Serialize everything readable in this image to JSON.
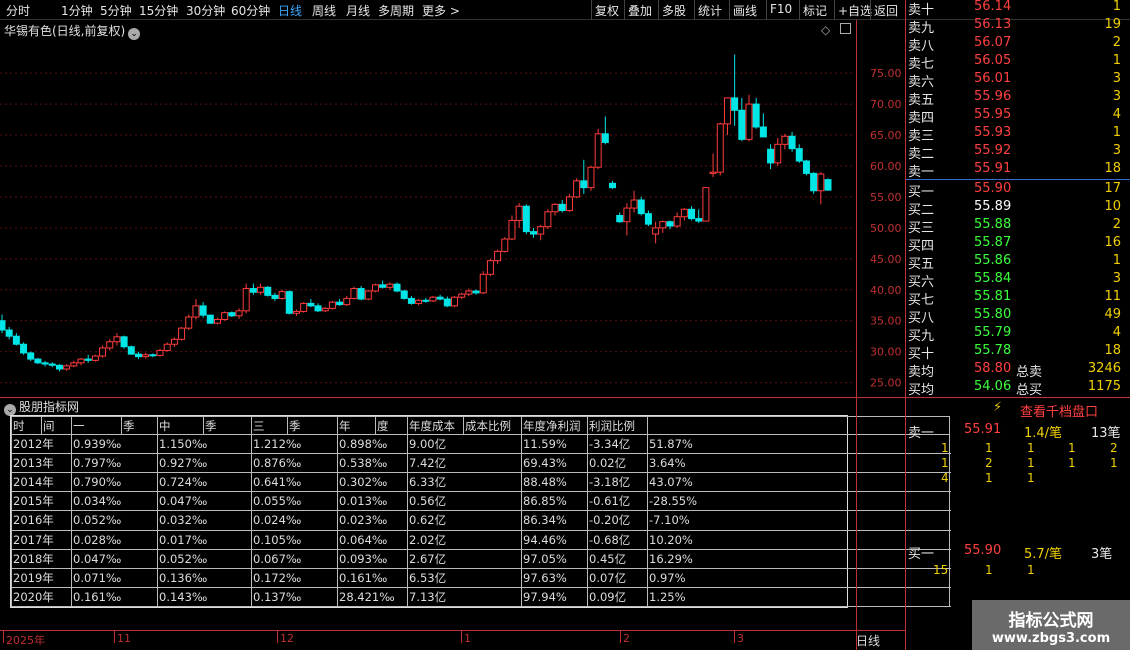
{
  "toolbar": {
    "periods": [
      "分时",
      "1分钟",
      "5分钟",
      "15分钟",
      "30分钟",
      "60分钟",
      "日线",
      "周线",
      "月线",
      "多周期",
      "更多 >"
    ],
    "active": "日线",
    "right_buttons": [
      "复权",
      "叠加",
      "多股",
      "统计",
      "画线",
      "F10",
      "标记",
      "+自选",
      "返回"
    ]
  },
  "chart": {
    "title": "华锡有色(日线,前复权)",
    "y_ticks": [
      "75.00",
      "70.00",
      "65.00",
      "60.00",
      "55.00",
      "50.00",
      "45.00",
      "40.00",
      "35.00",
      "30.00",
      "25.00"
    ],
    "x_ticks": [
      "2025年",
      "11",
      "12",
      "1",
      "2",
      "3"
    ],
    "period_label": "日线"
  },
  "chart_data": {
    "type": "candlestick",
    "title": "华锡有色(日线,前复权)",
    "ylim": [
      23,
      81
    ],
    "up_color": "#ff3c3c",
    "down_color": "#00e5e5",
    "ohlc": [
      [
        35,
        36,
        33,
        33.5
      ],
      [
        33.5,
        34,
        32,
        32.5
      ],
      [
        32.5,
        33,
        31,
        31.2
      ],
      [
        31.2,
        31.5,
        29.5,
        29.8
      ],
      [
        29.8,
        30,
        28.5,
        28.8
      ],
      [
        28.8,
        29,
        28,
        28.2
      ],
      [
        28.2,
        28.5,
        27.6,
        28
      ],
      [
        28,
        28.3,
        27.5,
        27.8
      ],
      [
        27.8,
        28,
        26.8,
        27.2
      ],
      [
        27.2,
        28,
        26.9,
        27.7
      ],
      [
        27.7,
        28.5,
        27.5,
        28.2
      ],
      [
        28.2,
        29,
        27.8,
        28.8
      ],
      [
        28.8,
        29.5,
        28.2,
        28.6
      ],
      [
        28.6,
        29.5,
        28.4,
        29.3
      ],
      [
        29.3,
        31,
        29,
        30.6
      ],
      [
        30.6,
        32,
        30.2,
        31.6
      ],
      [
        31.6,
        33,
        31,
        32.4
      ],
      [
        32.4,
        32.6,
        30.5,
        30.8
      ],
      [
        30.8,
        31,
        29.5,
        29.6
      ],
      [
        29.6,
        30,
        28.8,
        29.2
      ],
      [
        29.2,
        29.8,
        28.9,
        29.5
      ],
      [
        29.5,
        29.7,
        29.1,
        29.4
      ],
      [
        29.4,
        30.5,
        29.2,
        30.2
      ],
      [
        30.2,
        31.5,
        30,
        31.2
      ],
      [
        31.2,
        32.3,
        30.8,
        32
      ],
      [
        32,
        34,
        31.8,
        33.8
      ],
      [
        33.8,
        36,
        33.5,
        35.6
      ],
      [
        35.6,
        38.5,
        35.2,
        37.4
      ],
      [
        37.4,
        38,
        35.5,
        35.9
      ],
      [
        35.9,
        36,
        34.5,
        34.6
      ],
      [
        34.6,
        35.5,
        34.4,
        35.2
      ],
      [
        35.2,
        36.5,
        35,
        36.3
      ],
      [
        36.3,
        36.5,
        35.6,
        35.8
      ],
      [
        35.8,
        37,
        35.3,
        36.6
      ],
      [
        36.6,
        41,
        36.2,
        40.2
      ],
      [
        40.2,
        41,
        39.2,
        39.6
      ],
      [
        39.6,
        41,
        39.2,
        40.4
      ],
      [
        40.4,
        40.6,
        38.9,
        39.1
      ],
      [
        39.1,
        39.5,
        38.2,
        38.6
      ],
      [
        38.6,
        40,
        38.4,
        39.7
      ],
      [
        39.7,
        39.9,
        36,
        36.2
      ],
      [
        36.2,
        36.8,
        35.8,
        36.5
      ],
      [
        36.5,
        38,
        36.3,
        37.8
      ],
      [
        37.8,
        38.5,
        37.2,
        37.4
      ],
      [
        37.4,
        37.8,
        36.4,
        36.6
      ],
      [
        36.6,
        37.2,
        36.4,
        37
      ],
      [
        37,
        38.2,
        36.8,
        38
      ],
      [
        38,
        38.5,
        37.4,
        37.6
      ],
      [
        37.6,
        39,
        37.4,
        38.6
      ],
      [
        38.6,
        40.5,
        38.4,
        40.2
      ],
      [
        40.2,
        40.6,
        38.3,
        38.5
      ],
      [
        38.5,
        40,
        38.3,
        39.8
      ],
      [
        39.8,
        41,
        39.6,
        40.8
      ],
      [
        40.8,
        41.5,
        40.2,
        40.4
      ],
      [
        40.4,
        41.2,
        40,
        40.9
      ],
      [
        40.9,
        41.2,
        39.6,
        39.8
      ],
      [
        39.8,
        40,
        38.4,
        38.6
      ],
      [
        38.6,
        39,
        37.6,
        37.8
      ],
      [
        37.8,
        38.5,
        37.5,
        38.3
      ],
      [
        38.3,
        38.7,
        37.9,
        38.2
      ],
      [
        38.2,
        39,
        38,
        38.8
      ],
      [
        38.8,
        39.2,
        38.3,
        38.5
      ],
      [
        38.5,
        38.9,
        37.2,
        37.4
      ],
      [
        37.4,
        39,
        37.2,
        38.8
      ],
      [
        38.8,
        39.5,
        38.5,
        39.3
      ],
      [
        39.3,
        40.2,
        39,
        39.8
      ],
      [
        39.8,
        40,
        39.2,
        39.5
      ],
      [
        39.5,
        43,
        39.3,
        42.5
      ],
      [
        42.5,
        45,
        42.2,
        44.7
      ],
      [
        44.7,
        46.5,
        44.2,
        46.2
      ],
      [
        46.2,
        48.5,
        46,
        48.2
      ],
      [
        48.2,
        52,
        48,
        51.2
      ],
      [
        51.2,
        54,
        50,
        53.5
      ],
      [
        53.5,
        53.8,
        49,
        49.4
      ],
      [
        49.4,
        50,
        48.4,
        49
      ],
      [
        49,
        50.5,
        48,
        50.2
      ],
      [
        50.2,
        53,
        49.8,
        52.6
      ],
      [
        52.6,
        54,
        52,
        53.8
      ],
      [
        53.8,
        54.5,
        52.5,
        52.8
      ],
      [
        52.8,
        55.5,
        52.6,
        55
      ],
      [
        55,
        58,
        54.8,
        57.6
      ],
      [
        57.6,
        61,
        55.5,
        56.5
      ],
      [
        56.5,
        60,
        56,
        59.8
      ],
      [
        59.8,
        66,
        59.5,
        65.2
      ],
      [
        65.2,
        68,
        63.5,
        63.8
      ],
      [
        57.2,
        57.6,
        56.3,
        56.5
      ],
      [
        52,
        52.5,
        50.8,
        51
      ],
      [
        51,
        54,
        48.8,
        53.2
      ],
      [
        53.2,
        56,
        52.5,
        54.5
      ],
      [
        54.5,
        55,
        52,
        52.3
      ],
      [
        52.3,
        52.8,
        50.3,
        50.6
      ],
      [
        49,
        51,
        47.5,
        50
      ],
      [
        50,
        51.2,
        49.2,
        51
      ],
      [
        51,
        51.2,
        49.8,
        50.3
      ],
      [
        50.3,
        52.5,
        50,
        51.8
      ],
      [
        51.8,
        53.2,
        51.2,
        53
      ],
      [
        53,
        53.5,
        51.2,
        51.5
      ],
      [
        51.5,
        53,
        50.8,
        51.1
      ],
      [
        51.1,
        56,
        51,
        56.5
      ],
      [
        58.8,
        62,
        58.2,
        59
      ],
      [
        59,
        67,
        58.5,
        66.8
      ],
      [
        66.8,
        71,
        65,
        71
      ],
      [
        71,
        78,
        66.5,
        69
      ],
      [
        69,
        71,
        64,
        64.3
      ],
      [
        64.3,
        71.5,
        64,
        70
      ],
      [
        70,
        71,
        66,
        66.3
      ],
      [
        66.3,
        68.5,
        65.7,
        64.7
      ],
      [
        62.7,
        63.5,
        59.5,
        60.5
      ],
      [
        60.5,
        64.5,
        60,
        63.5
      ],
      [
        63.5,
        65.2,
        62.7,
        64.8
      ],
      [
        64.8,
        65.5,
        62.3,
        62.8
      ],
      [
        62.8,
        63.5,
        60.5,
        60.8
      ],
      [
        60.8,
        61,
        58.5,
        58.8
      ],
      [
        58.8,
        59,
        55.5,
        56
      ],
      [
        56,
        59,
        53.8,
        58.7
      ],
      [
        57.8,
        58,
        56,
        56.1
      ]
    ]
  },
  "indicator": {
    "title": "股朋指标网",
    "headers": [
      "时",
      "间",
      "一",
      "季",
      "中",
      "季",
      "三",
      "季",
      "年",
      "度",
      "年度成本",
      "成本比例",
      "年度净利润",
      "利润比例"
    ],
    "rows": [
      [
        "2012年",
        "0.939‰",
        "1.150‰",
        "1.212‰",
        "0.898‰",
        "9.00亿",
        "11.59%",
        "-3.34亿",
        "51.87%"
      ],
      [
        "2013年",
        "0.797‰",
        "0.927‰",
        "0.876‰",
        "0.538‰",
        "7.42亿",
        "69.43%",
        "0.02亿",
        "3.64%"
      ],
      [
        "2014年",
        "0.790‰",
        "0.724‰",
        "0.641‰",
        "0.302‰",
        "6.33亿",
        "88.48%",
        "-3.18亿",
        "43.07%"
      ],
      [
        "2015年",
        "0.034‰",
        "0.047‰",
        "0.055‰",
        "0.013‰",
        "0.56亿",
        "86.85%",
        "-0.61亿",
        "-28.55%"
      ],
      [
        "2016年",
        "0.052‰",
        "0.032‰",
        "0.024‰",
        "0.023‰",
        "0.62亿",
        "86.34%",
        "-0.20亿",
        "-7.10%"
      ],
      [
        "2017年",
        "0.028‰",
        "0.017‰",
        "0.105‰",
        "0.064‰",
        "2.02亿",
        "94.46%",
        "-0.68亿",
        "10.20%"
      ],
      [
        "2018年",
        "0.047‰",
        "0.052‰",
        "0.067‰",
        "0.093‰",
        "2.67亿",
        "97.05%",
        "0.45亿",
        "16.29%"
      ],
      [
        "2019年",
        "0.071‰",
        "0.136‰",
        "0.172‰",
        "0.161‰",
        "6.53亿",
        "97.63%",
        "0.07亿",
        "0.97%"
      ],
      [
        "2020年",
        "0.161‰",
        "0.143‰",
        "0.137‰",
        "28.421‰",
        "7.13亿",
        "97.94%",
        "0.09亿",
        "1.25%"
      ]
    ]
  },
  "orderbook": {
    "asks": [
      {
        "label": "卖十",
        "price": "56.14",
        "vol": "1",
        "color": "up"
      },
      {
        "label": "卖九",
        "price": "56.13",
        "vol": "19",
        "color": "up"
      },
      {
        "label": "卖八",
        "price": "56.07",
        "vol": "2",
        "color": "up"
      },
      {
        "label": "卖七",
        "price": "56.05",
        "vol": "1",
        "color": "up"
      },
      {
        "label": "卖六",
        "price": "56.01",
        "vol": "3",
        "color": "up"
      },
      {
        "label": "卖五",
        "price": "55.96",
        "vol": "3",
        "color": "up"
      },
      {
        "label": "卖四",
        "price": "55.95",
        "vol": "4",
        "color": "up"
      },
      {
        "label": "卖三",
        "price": "55.93",
        "vol": "1",
        "color": "up"
      },
      {
        "label": "卖二",
        "price": "55.92",
        "vol": "3",
        "color": "up"
      },
      {
        "label": "卖一",
        "price": "55.91",
        "vol": "18",
        "color": "up"
      }
    ],
    "bids": [
      {
        "label": "买一",
        "price": "55.90",
        "vol": "17",
        "color": "up"
      },
      {
        "label": "买二",
        "price": "55.89",
        "vol": "10",
        "color": "wh"
      },
      {
        "label": "买三",
        "price": "55.88",
        "vol": "2",
        "color": "dn"
      },
      {
        "label": "买四",
        "price": "55.87",
        "vol": "16",
        "color": "dn"
      },
      {
        "label": "买五",
        "price": "55.86",
        "vol": "1",
        "color": "dn"
      },
      {
        "label": "买六",
        "price": "55.84",
        "vol": "3",
        "color": "dn"
      },
      {
        "label": "买七",
        "price": "55.81",
        "vol": "11",
        "color": "dn"
      },
      {
        "label": "买八",
        "price": "55.80",
        "vol": "49",
        "color": "dn"
      },
      {
        "label": "买九",
        "price": "55.79",
        "vol": "4",
        "color": "dn"
      },
      {
        "label": "买十",
        "price": "55.78",
        "vol": "18",
        "color": "dn"
      }
    ],
    "avg_sell_label": "卖均",
    "avg_sell": "58.80",
    "total_sell_label": "总卖",
    "total_sell": "3246",
    "avg_buy_label": "买均",
    "avg_buy": "54.06",
    "total_buy_label": "总买",
    "total_buy": "1175"
  },
  "depth": {
    "link": "查看千档盘口",
    "sell1_label": "卖一",
    "sell1_price": "55.91",
    "sell1_avg": "1.4/笔",
    "sell1_count": "13笔",
    "sell_ticks": [
      [
        "1",
        "1",
        "1",
        "1",
        "2"
      ],
      [
        "1",
        "2",
        "1",
        "1",
        "1"
      ],
      [
        "4",
        "1",
        "1"
      ]
    ],
    "buy1_label": "买一",
    "buy1_price": "55.90",
    "buy1_avg": "5.7/笔",
    "buy1_count": "3笔",
    "buy_ticks": [
      [
        "15",
        "1",
        "1"
      ]
    ]
  },
  "watermark": {
    "line1": "指标公式网",
    "line2": "www.zbgs3.com"
  }
}
